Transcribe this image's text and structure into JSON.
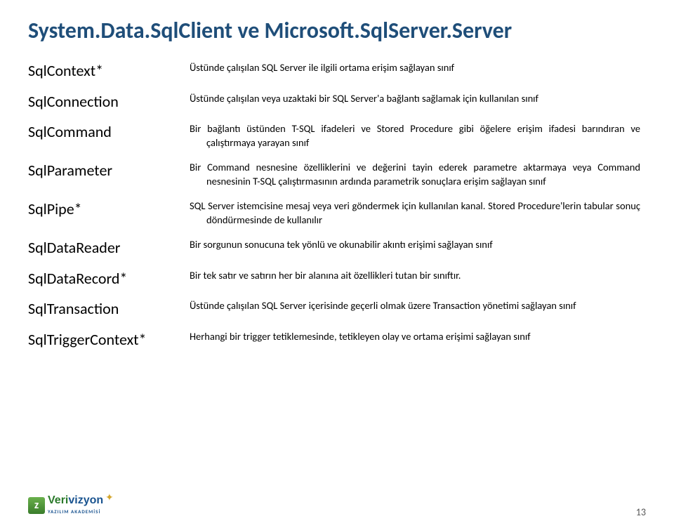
{
  "title": "System.Data.SqlClient ve Microsoft.SqlServer.Server",
  "rows": [
    {
      "name": "SqlContext*",
      "desc": "Üstünde çalışılan SQL Server ile ilgili ortama erişim sağlayan sınıf"
    },
    {
      "name": "SqlConnection",
      "desc": "Üstünde çalışılan veya uzaktaki bir SQL Server'a bağlantı sağlamak için kullanılan sınıf"
    },
    {
      "name": "SqlCommand",
      "desc": "Bir bağlantı üstünden T-SQL ifadeleri ve Stored Procedure gibi öğelere erişim ifadesi barındıran ve çalıştırmaya yarayan sınıf"
    },
    {
      "name": "SqlParameter",
      "desc": "Bir Command nesnesine özelliklerini ve değerini tayin ederek parametre aktarmaya veya Command nesnesinin T-SQL çalıştırmasının ardında parametrik sonuçlara erişim sağlayan sınıf"
    },
    {
      "name": "SqlPipe*",
      "desc": "SQL Server istemcisine mesaj veya veri göndermek için kullanılan kanal. Stored Procedure'lerin tabular sonuç döndürmesinde de kullanılır"
    },
    {
      "name": "SqlDataReader",
      "desc": "Bir sorgunun sonucuna tek yönlü ve okunabilir akıntı erişimi sağlayan sınıf"
    },
    {
      "name": "SqlDataRecord*",
      "desc": "Bir tek satır ve satırın her bir alanına ait özellikleri tutan bir sınıftır."
    },
    {
      "name": "SqlTransaction",
      "desc": "Üstünde çalışılan SQL Server içerisinde geçerli olmak üzere Transaction yönetimi sağlayan sınıf"
    },
    {
      "name": "SqlTriggerContext*",
      "desc": "Herhangi bir trigger tetiklemesinde, tetikleyen olay ve ortama erişimi sağlayan sınıf"
    }
  ],
  "logo": {
    "brand_v": "Veri",
    "brand_rest": "vizyon",
    "z": "z",
    "sub": "YAZILIM AKADEMİSİ"
  },
  "page_number": "13"
}
